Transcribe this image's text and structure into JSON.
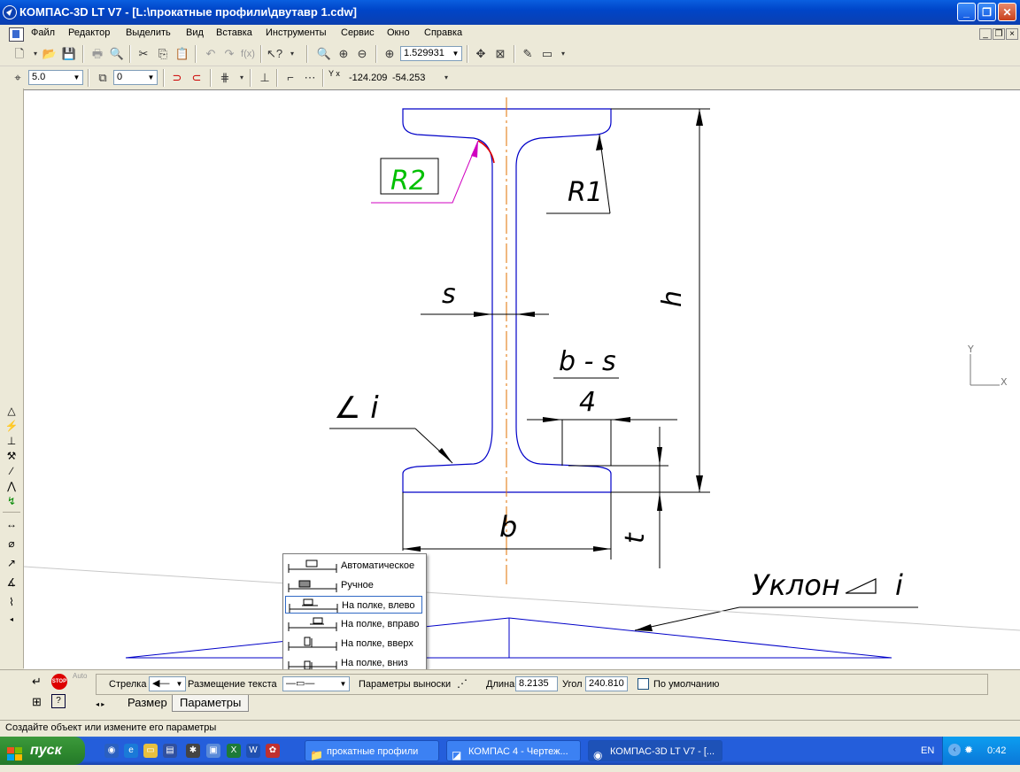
{
  "titlebar": {
    "title": "КОМПАС-3D LT V7 - [L:\\прокатные профили\\двутавр 1.cdw]",
    "minimize": "_",
    "maximize": "❐",
    "close": "✕"
  },
  "menu": {
    "items": [
      "Файл",
      "Редактор",
      "Выделить",
      "Вид",
      "Вставка",
      "Инструменты",
      "Сервис",
      "Окно",
      "Справка"
    ],
    "mdi": [
      "_",
      "❐",
      "×"
    ]
  },
  "toolbar1": {
    "zoom_value": "1.529931"
  },
  "toolbar2": {
    "step_value": "5.0",
    "layer_value": "0",
    "coord_label": "Y x",
    "coord_x": "-124.209",
    "coord_y": "-54.253"
  },
  "drawing": {
    "labels": {
      "r2": "R2",
      "r1": "R1",
      "s": "s",
      "h": "h",
      "b_minus_s": "b - s",
      "four": "4",
      "angle_i": "∠ i",
      "b": "b",
      "t": "t",
      "slope_text": "Уклон",
      "slope_i": "i"
    },
    "axes": {
      "y": "Y",
      "x": "X"
    },
    "colors": {
      "outline": "#0000c8",
      "red": "#e00000",
      "axis": "#e07000",
      "magenta": "#d000c0",
      "green": "#00c000"
    }
  },
  "popup": {
    "items": [
      {
        "label": "Автоматическое"
      },
      {
        "label": "Ручное"
      },
      {
        "label": "На полке, влево",
        "selected": true
      },
      {
        "label": "На полке, вправо"
      },
      {
        "label": "На полке, вверх"
      },
      {
        "label": "На полке, вниз"
      }
    ]
  },
  "propbar": {
    "arrow_label": "Стрелка",
    "text_place_label": "Размещение текста",
    "leader_params_label": "Параметры выноски",
    "length_label": "Длина",
    "length_value": "8.2135",
    "angle_label": "Угол",
    "angle_value": "240.810",
    "default_label": "По умолчанию",
    "auto_label": "Auto",
    "tabs": [
      "Размер",
      "Параметры"
    ]
  },
  "status": {
    "text": "Создайте объект или измените его параметры"
  },
  "taskbar": {
    "start": "пуск",
    "buttons": [
      "прокатные профили",
      "КОМПАС 4 - Чертеж...",
      "КОМПАС-3D LT V7 - [..."
    ],
    "lang": "EN",
    "clock": "0:42"
  }
}
